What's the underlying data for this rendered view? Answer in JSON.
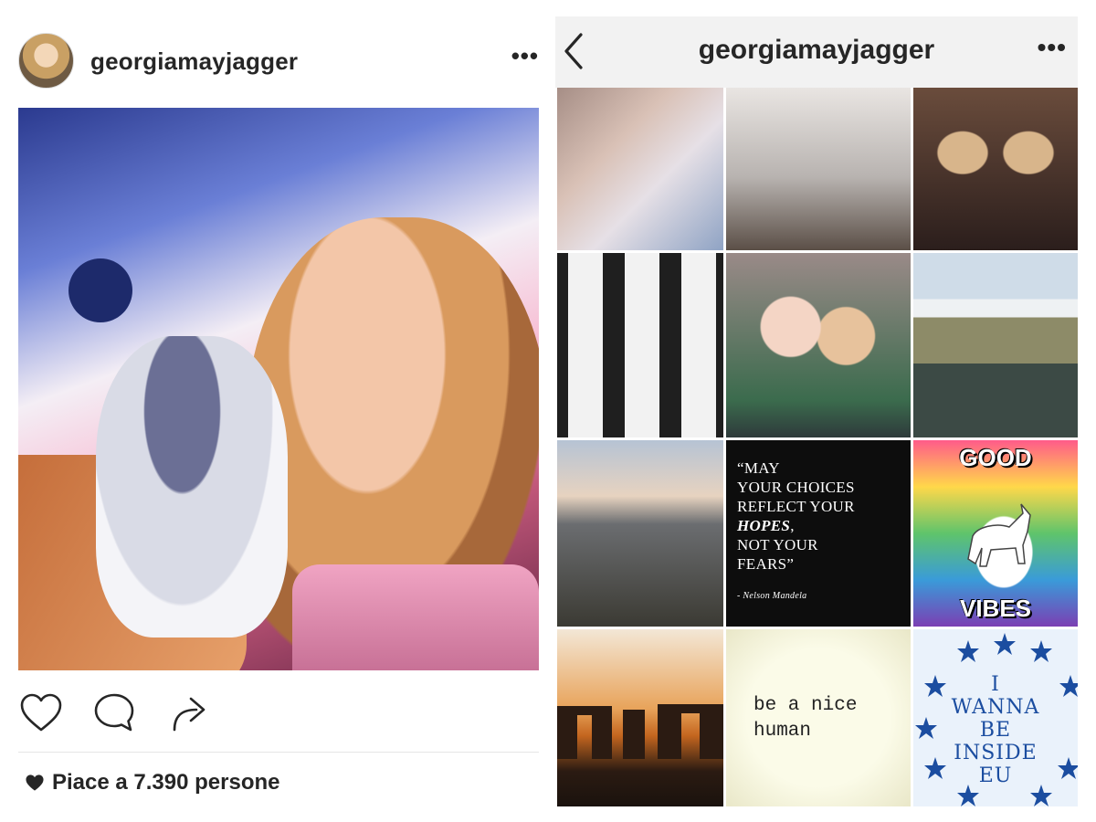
{
  "post": {
    "username": "georgiamayjagger",
    "more_label": "•••",
    "likes_text": "Piace a 7.390 persone",
    "icons": [
      "heart-icon",
      "comment-icon",
      "share-icon"
    ]
  },
  "profile": {
    "username": "georgiamayjagger",
    "more_label": "•••",
    "back_icon": "chevron-left-icon",
    "grid": {
      "quote": {
        "line1": "“MAY",
        "line2": "YOUR CHOICES",
        "line3": "REFLECT YOUR",
        "hopes": "HOPES",
        "line4_suffix": ",",
        "line5": "NOT YOUR",
        "line6": "FEARS”",
        "author": "- Nelson Mandela"
      },
      "vibes": {
        "top": "GOOD",
        "bottom": "VIBES"
      },
      "nice": {
        "line1": "be a nice",
        "line2": "human"
      },
      "eu": {
        "line1": "I",
        "line2": "WANNA",
        "line3": "BE",
        "line4": "INSIDE",
        "line5": "EU"
      }
    }
  },
  "colors": {
    "text": "#262626",
    "topbar_bg": "#f2f2f2",
    "divider": "#e6e6e6",
    "eu_blue": "#1b4da0"
  }
}
